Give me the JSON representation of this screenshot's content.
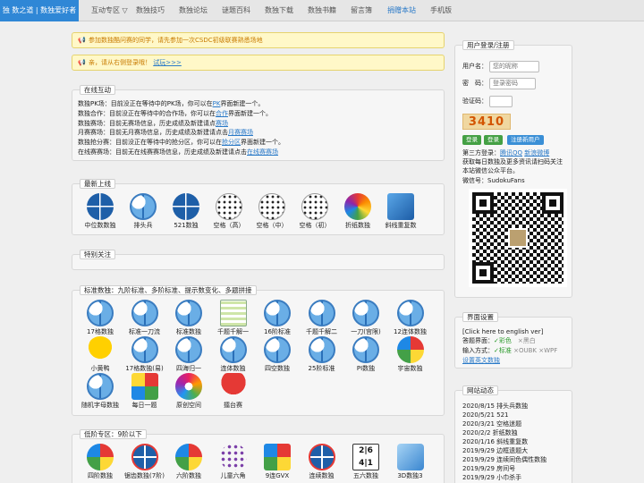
{
  "nav": {
    "brand": "独 数之道 | 数独爱好者",
    "items": [
      {
        "label": "互动专区 ▽",
        "highlight": false
      },
      {
        "label": "数独技巧",
        "highlight": false
      },
      {
        "label": "数独论坛",
        "highlight": false
      },
      {
        "label": "谜题百科",
        "highlight": false
      },
      {
        "label": "数独下载",
        "highlight": false
      },
      {
        "label": "数独书籍",
        "highlight": false
      },
      {
        "label": "留言簿",
        "highlight": false
      },
      {
        "label": "捐赠本站",
        "highlight": true
      },
      {
        "label": "手机版",
        "highlight": false
      }
    ]
  },
  "notices": {
    "n1": "参加数独酷问赛的同学，请先参加一次CSDC初级联赛熟悉场地",
    "n2_text": "亲，请从右侧登录哦！",
    "n2_link": "试玩>>>"
  },
  "online": {
    "title": "在线互动",
    "lines": [
      {
        "pre": "数独PK场：目前没正在等待中的PK场，你可以在",
        "link": "PK",
        "post": "界面新建一个。"
      },
      {
        "pre": "数独合作：目前没正在等待中的合作场，你可以在",
        "link": "合作",
        "post": "界面新建一个。"
      },
      {
        "pre": "数独赛场：目前无赛场信息，历史成绩及新建请点",
        "link": "赛场",
        "post": ""
      },
      {
        "pre": "月赛赛场：目前无月赛场信息，历史成绩及新建请点击",
        "link": "月赛赛场",
        "post": ""
      },
      {
        "pre": "数独抢分赛：目前没正在等待中的抢分区，你可以在",
        "link": "抢分区",
        "post": "界面新建一个。"
      },
      {
        "pre": "在线赛赛场：目前无在线赛赛场信息，历史成绩及新建请点击",
        "link": "在线赛赛场",
        "post": ""
      }
    ]
  },
  "newest": {
    "title": "最新上线",
    "items": [
      {
        "label": "中位数数独",
        "icon": "blue-grid"
      },
      {
        "label": "排头兵",
        "icon": "std"
      },
      {
        "label": "521数独",
        "icon": "blue-grid"
      },
      {
        "label": "空格（高）",
        "icon": "dots"
      },
      {
        "label": "空格（中）",
        "icon": "dots"
      },
      {
        "label": "空格（初）",
        "icon": "dots"
      },
      {
        "label": "折纸数独",
        "icon": "rainbow"
      },
      {
        "label": "斜线重复数",
        "icon": "cube"
      }
    ]
  },
  "special": {
    "title": "特别关注"
  },
  "standard": {
    "title": "标准数独：九阶标准、多阶标准、提示数变化、多题拼接",
    "items": [
      {
        "label": "17格数独",
        "icon": "std"
      },
      {
        "label": "标准一刀流",
        "icon": "std"
      },
      {
        "label": "标准数独",
        "icon": "std"
      },
      {
        "label": "千题千解一",
        "icon": "paper"
      },
      {
        "label": "16阶标准",
        "icon": "std"
      },
      {
        "label": "千题千解二",
        "icon": "std"
      },
      {
        "label": "一刀(宫限)",
        "icon": "std"
      },
      {
        "label": "12连体数独",
        "icon": "std"
      },
      {
        "label": "小黄鸭",
        "icon": "duck"
      },
      {
        "label": "17格数独(易)",
        "icon": "std"
      },
      {
        "label": "四海归一",
        "icon": "std"
      },
      {
        "label": "连体数独",
        "icon": "std"
      },
      {
        "label": "四空数独",
        "icon": "std"
      },
      {
        "label": "25阶标准",
        "icon": "std"
      },
      {
        "label": "PI数独",
        "icon": "std"
      },
      {
        "label": "宇宙数独",
        "icon": "pie"
      },
      {
        "label": "随机字母数独",
        "icon": "std"
      },
      {
        "label": "每日一题",
        "icon": "mosaic"
      },
      {
        "label": "原创空间",
        "icon": "flower"
      },
      {
        "label": "擂台赛",
        "icon": "trophy"
      }
    ]
  },
  "lowlevel": {
    "title": "低阶专区：9阶以下",
    "items": [
      {
        "label": "四阶数独",
        "icon": "pie"
      },
      {
        "label": "锯齿数独(7阶)",
        "icon": "target"
      },
      {
        "label": "六阶数独",
        "icon": "pie"
      },
      {
        "label": "儿童六角",
        "icon": "purple"
      },
      {
        "label": "9连GVX",
        "icon": "gvx"
      },
      {
        "label": "连续数独",
        "icon": "target"
      },
      {
        "label": "五六数独",
        "icon": "frac",
        "glyph": "2|6 4|1"
      },
      {
        "label": "3D数独3",
        "icon": "d3"
      }
    ]
  },
  "login": {
    "title": "用户登录/注册",
    "username_label": "用户名：",
    "username_placeholder": "您的昵称",
    "password_label": "密　码：",
    "password_placeholder": "登录密码",
    "captcha_label": "验证码：",
    "captcha_text": "3410",
    "btn_login": "登录",
    "btn_reg": "登录",
    "btn_new": "注册新用户",
    "third_label": "第三方登录：",
    "third_qq": "腾讯QQ",
    "third_weibo": "新浪微博",
    "promo1": "获取每日数独及更多资讯请扫码关注",
    "promo2": "本站微信公众平台。",
    "wechat": "微信号：SudokuFans"
  },
  "settings": {
    "title": "界面设置",
    "english": "[Click here to english ver]",
    "colors_label": "答题界面：",
    "color_opt1": "✓彩色",
    "color_opt2": "×黑白",
    "input_label": "输入方式：",
    "input_opt1": "✓标准",
    "input_opt2": "×OUBK",
    "input_opt3": "×WPF",
    "link": "设置英文数独"
  },
  "news": {
    "title": "网站动态",
    "items": [
      "2020/8/15 排头兵数独",
      "2020/5/21 521",
      "2020/3/21 空格迷题",
      "2020/2/2 折纸数独",
      "2020/1/16 斜线重复数",
      "2019/9/29 边框遗题大",
      "2019/9/29 连续同色偶性数独",
      "2019/9/29 房间号",
      "2019/9/29 小巾杀手"
    ]
  }
}
